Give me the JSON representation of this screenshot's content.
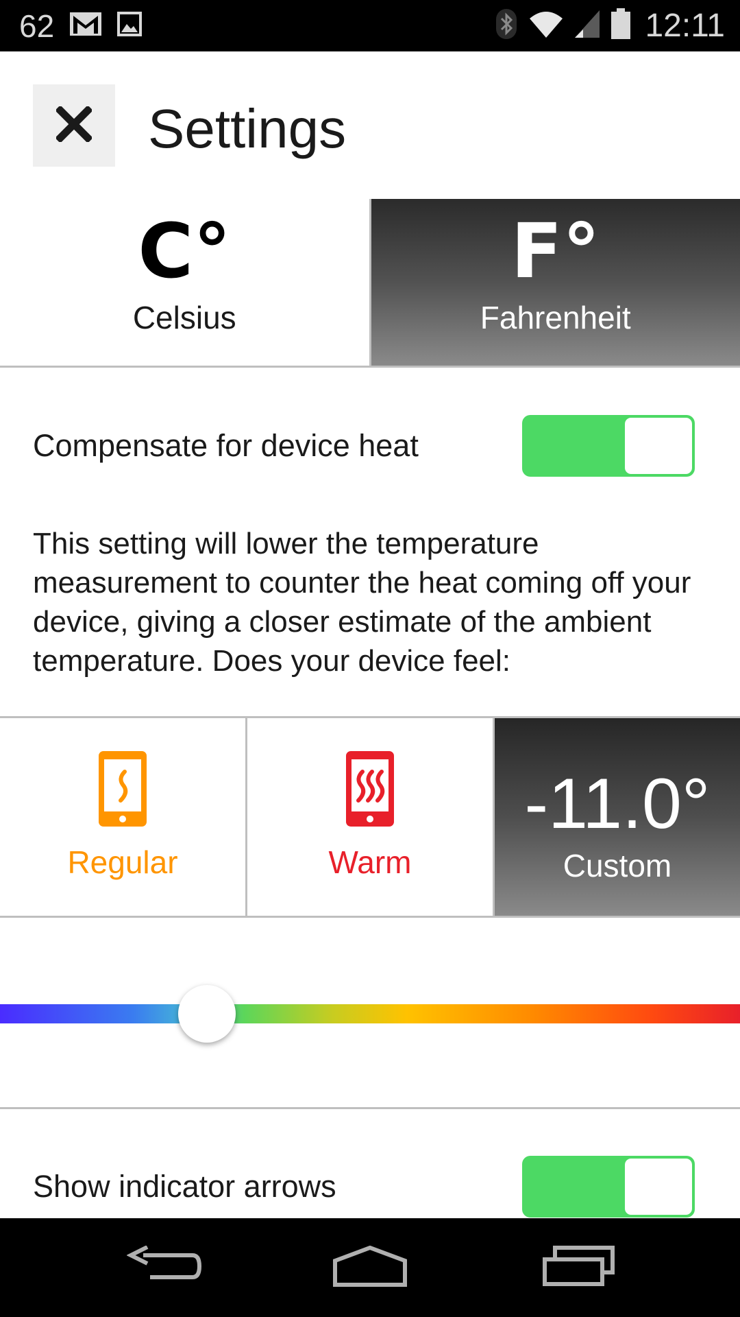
{
  "status_bar": {
    "notification_count": "62",
    "time": "12:11",
    "icons": [
      "gmail-icon",
      "image-icon",
      "bluetooth-icon",
      "wifi-icon",
      "signal-icon",
      "battery-icon"
    ]
  },
  "header": {
    "title": "Settings",
    "close_icon": "close-icon"
  },
  "units": {
    "celsius": {
      "symbol": "C°",
      "label": "Celsius"
    },
    "fahrenheit": {
      "symbol": "F°",
      "label": "Fahrenheit"
    },
    "selected": "fahrenheit"
  },
  "compensate": {
    "label": "Compensate for device heat",
    "enabled": true,
    "description": "This setting will lower the temperature measurement to counter the heat coming off your device, giving a closer estimate of the ambient temperature. Does your device feel:"
  },
  "presets": {
    "regular": {
      "label": "Regular",
      "color": "#ff9500",
      "icon": "phone-mild-heat-icon"
    },
    "warm": {
      "label": "Warm",
      "color": "#e8202a",
      "icon": "phone-hot-icon"
    },
    "custom": {
      "value": "-11.0°",
      "label": "Custom"
    },
    "selected": "custom"
  },
  "slider": {
    "position_fraction": 0.28
  },
  "indicator_arrows": {
    "label": "Show indicator arrows",
    "enabled": true
  },
  "colors": {
    "switch_on": "#4cd964",
    "regular": "#ff9500",
    "warm": "#e8202a"
  },
  "nav": {
    "icons": [
      "back-icon",
      "home-icon",
      "recent-apps-icon"
    ]
  }
}
